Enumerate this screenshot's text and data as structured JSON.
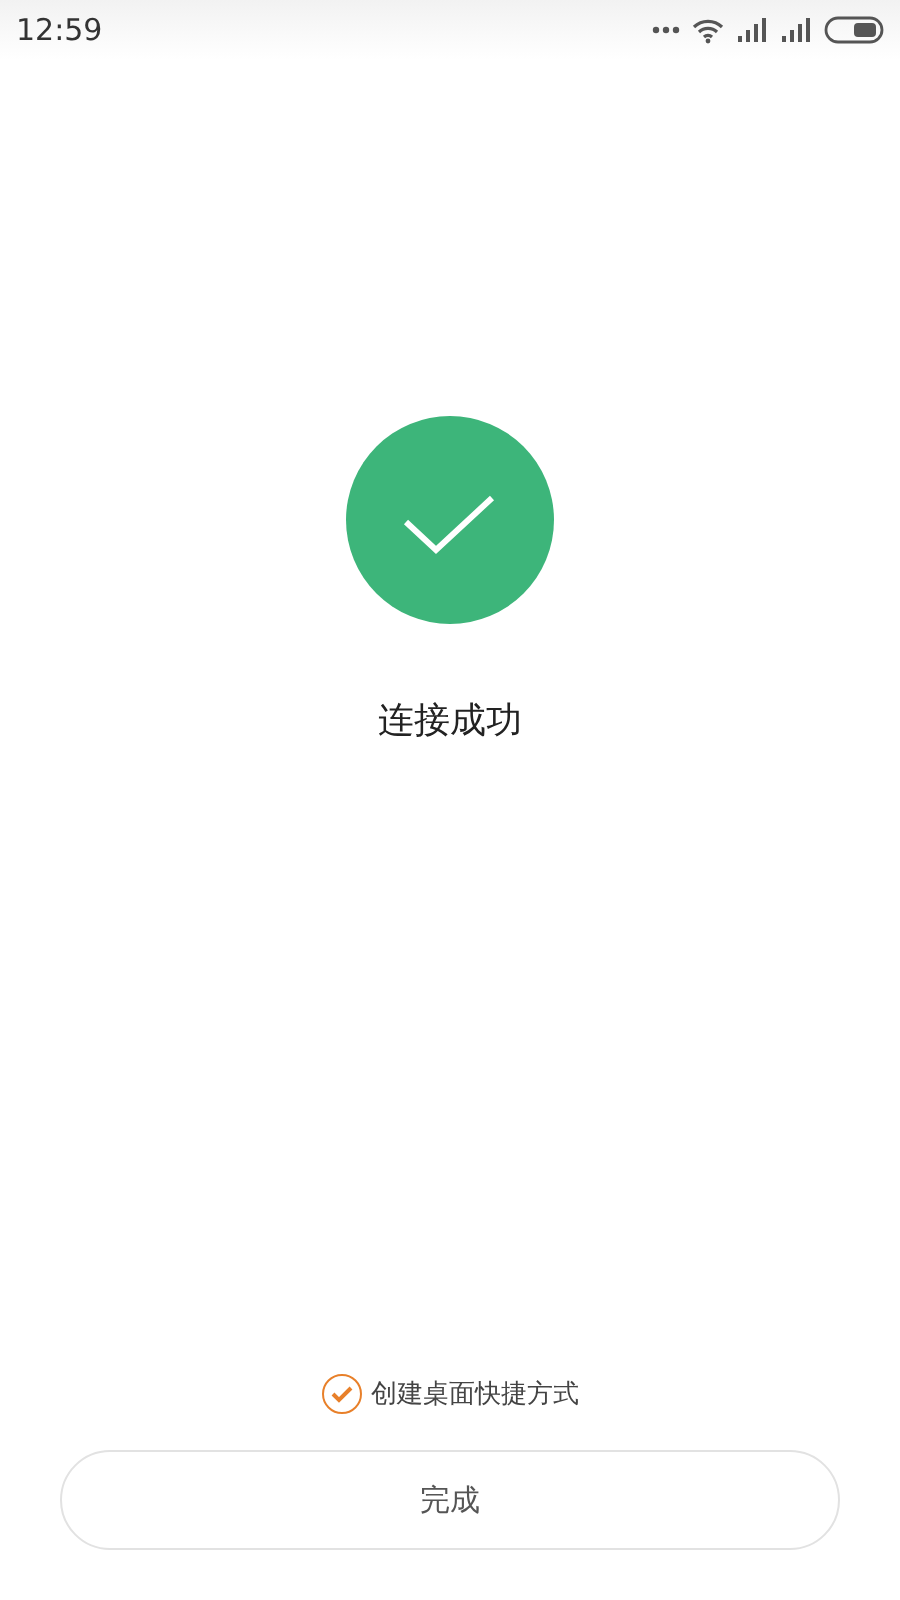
{
  "status_bar": {
    "time": "12:59"
  },
  "result": {
    "message": "连接成功"
  },
  "shortcut": {
    "label": "创建桌面快捷方式",
    "checked": true
  },
  "done_button": {
    "label": "完成"
  }
}
